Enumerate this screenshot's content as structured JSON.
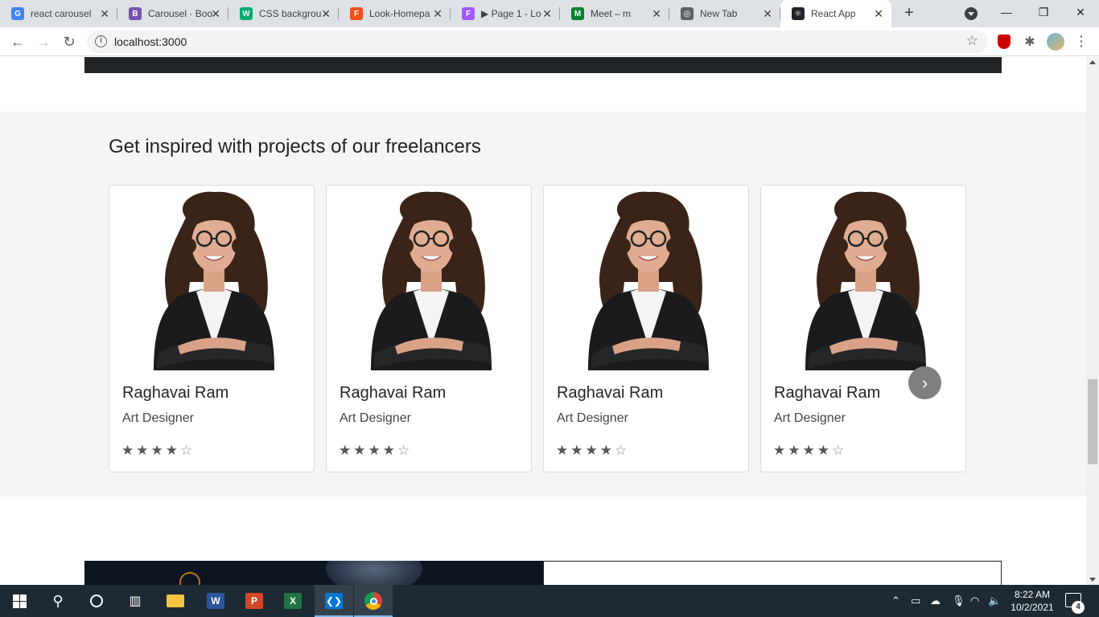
{
  "browser": {
    "tabs": [
      {
        "label": "react carousel",
        "favicon": "google-icon",
        "favicon_text": "G",
        "color": "#4285f4"
      },
      {
        "label": "Carousel · Boo",
        "favicon": "bootstrap-icon",
        "favicon_text": "B",
        "color": "#7952b3"
      },
      {
        "label": "CSS backgrou",
        "favicon": "w3schools-icon",
        "favicon_text": "W",
        "color": "#04aa6d"
      },
      {
        "label": "Look-Homepa",
        "favicon": "figma-icon",
        "favicon_text": "F",
        "color": "#f24e1e"
      },
      {
        "label": "▶ Page 1 - Lo",
        "favicon": "figma-icon",
        "favicon_text": "F",
        "color": "#a259ff"
      },
      {
        "label": "Meet – m",
        "favicon": "meet-icon",
        "favicon_text": "M",
        "color": "#00832d"
      },
      {
        "label": "New Tab",
        "favicon": "chrome-icon",
        "favicon_text": "◎",
        "color": "#5f6368"
      },
      {
        "label": "React App",
        "favicon": "react-icon",
        "favicon_text": "⚛",
        "color": "#20232a"
      }
    ],
    "url": "localhost:3000",
    "window_controls": {
      "minimize": "—",
      "restore": "❐",
      "close": "✕"
    }
  },
  "page": {
    "section_title": "Get inspired with projects of our freelancers",
    "cards": [
      {
        "name": "Raghavai Ram",
        "role": "Art Designer",
        "rating": 4,
        "max_rating": 5
      },
      {
        "name": "Raghavai Ram",
        "role": "Art Designer",
        "rating": 4,
        "max_rating": 5
      },
      {
        "name": "Raghavai Ram",
        "role": "Art Designer",
        "rating": 4,
        "max_rating": 5
      },
      {
        "name": "Raghavai Ram",
        "role": "Art Designer",
        "rating": 4,
        "max_rating": 5
      }
    ],
    "carousel_next_icon": "chevron-right-icon"
  },
  "taskbar": {
    "apps": [
      "windows-start-icon",
      "search-icon",
      "cortana-icon",
      "task-view-icon",
      "file-explorer-icon",
      "word-icon",
      "powerpoint-icon",
      "excel-icon",
      "vscode-icon",
      "chrome-icon"
    ],
    "time": "8:22 AM",
    "date": "10/2/2021",
    "notification_count": "4"
  }
}
